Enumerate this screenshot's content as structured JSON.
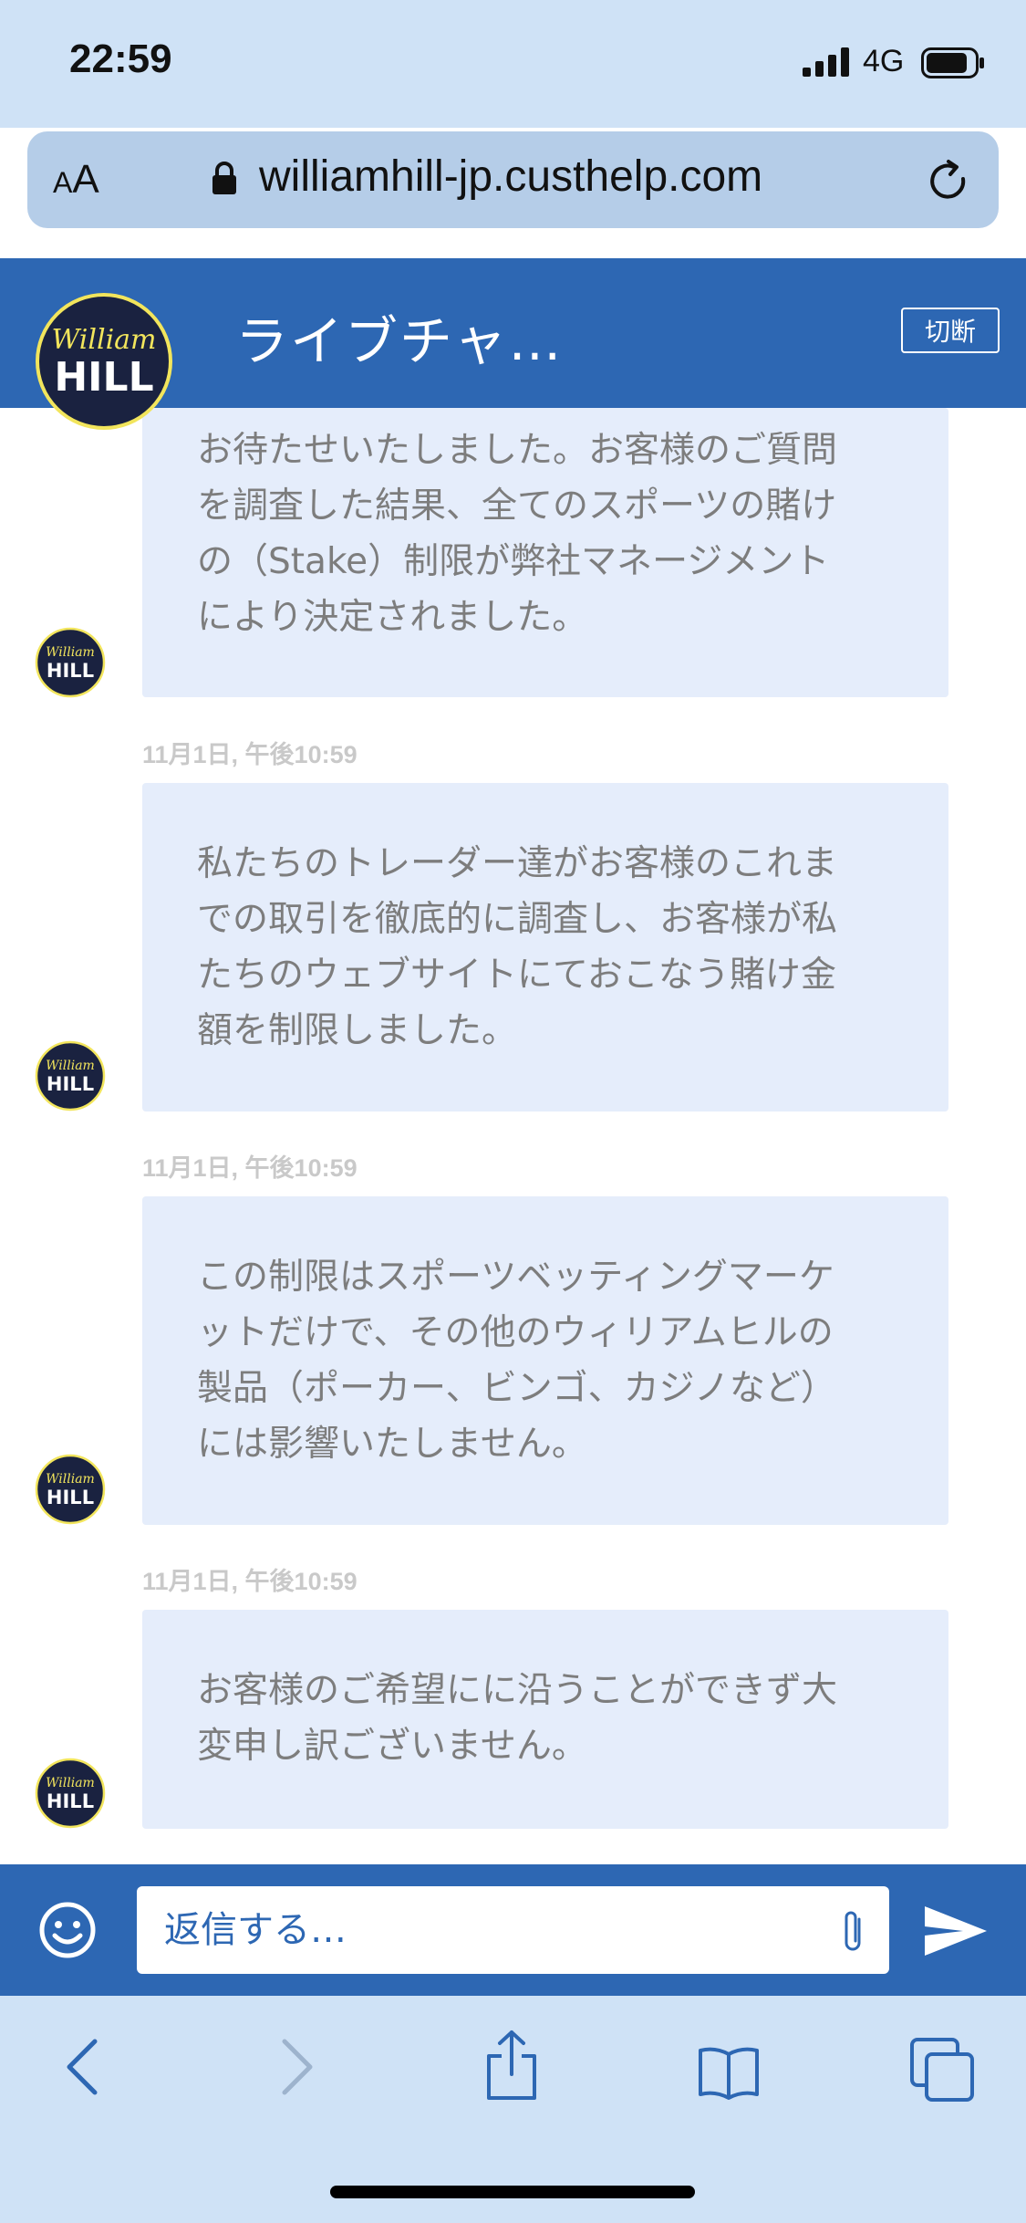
{
  "status_bar": {
    "time": "22:59",
    "network": "4G"
  },
  "browser": {
    "text_size_label_small": "A",
    "text_size_label_large": "A",
    "url": "williamhill-jp.custhelp.com"
  },
  "header": {
    "title": "ライブチャ…",
    "disconnect_label": "切断",
    "logo_text_script": "William",
    "logo_text_block": "HILL"
  },
  "messages": [
    {
      "text": "お待たせいたしました。お客様のご質問\nを調査した結果、全てのスポーツの賭け\nの（Stake）制限が弊社マネージメント\nにより決定されました。"
    },
    {
      "timestamp": "11月1日, 午後10:59",
      "text": "私たちのトレーダー達がお客様のこれま\nでの取引を徹底的に調査し、お客様が私\nたちのウェブサイトにておこなう賭け金\n額を制限しました。"
    },
    {
      "timestamp": "11月1日, 午後10:59",
      "text": "この制限はスポーツベッティングマーケ\nットだけで、その他のウィリアムヒルの\n製品（ポーカー、ビンゴ、カジノなど）\nには影響いたしません。"
    },
    {
      "timestamp": "11月1日, 午後10:59",
      "text": "お客様のご希望にに沿うことができず大\n変申し訳ございません。"
    }
  ],
  "composer": {
    "placeholder": "返信する…"
  },
  "colors": {
    "brand_blue": "#2d67b3",
    "bubble_bg": "#e5edfb",
    "browser_chrome": "#cfe2f6",
    "logo_navy": "#1a2240",
    "logo_yellow": "#f2e55c"
  },
  "icons": [
    "lock-icon",
    "reload-icon",
    "smiley-icon",
    "paperclip-icon",
    "send-icon",
    "back-icon",
    "forward-icon",
    "share-icon",
    "bookmarks-icon",
    "tabs-icon"
  ]
}
